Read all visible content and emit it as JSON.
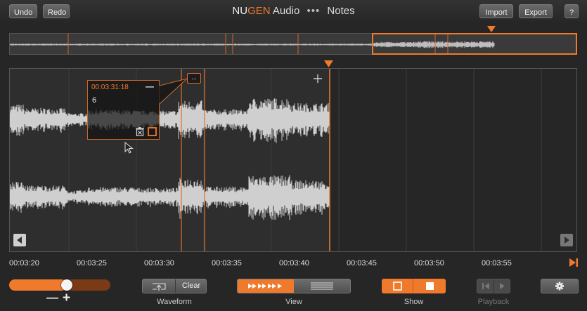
{
  "toolbar": {
    "undo_label": "Undo",
    "redo_label": "Redo",
    "import_label": "Import",
    "export_label": "Export",
    "help_label": "?"
  },
  "app": {
    "brand_nu": "NU",
    "brand_gen": "GEN",
    "brand_audio": "Audio",
    "separator": "•••",
    "name": "Notes"
  },
  "note_popup": {
    "timestamp": "00:03:31:18",
    "text": "6",
    "collapse_label": "—"
  },
  "marker_flag": {
    "label": "..."
  },
  "timeline": {
    "labels": [
      "00:03:20",
      "00:03:25",
      "00:03:30",
      "00:03:35",
      "00:03:40",
      "00:03:45",
      "00:03:50",
      "00:03:55"
    ]
  },
  "controls": {
    "zoom_minus": "—",
    "zoom_plus": "+",
    "zoom_level": 0.58,
    "clear_label": "Clear",
    "waveform_label": "Waveform",
    "view_label": "View",
    "show_label": "Show",
    "playback_label": "Playback"
  },
  "colors": {
    "accent": "#f07a2c",
    "background": "#262626",
    "waveform": "#cfcfcf"
  }
}
